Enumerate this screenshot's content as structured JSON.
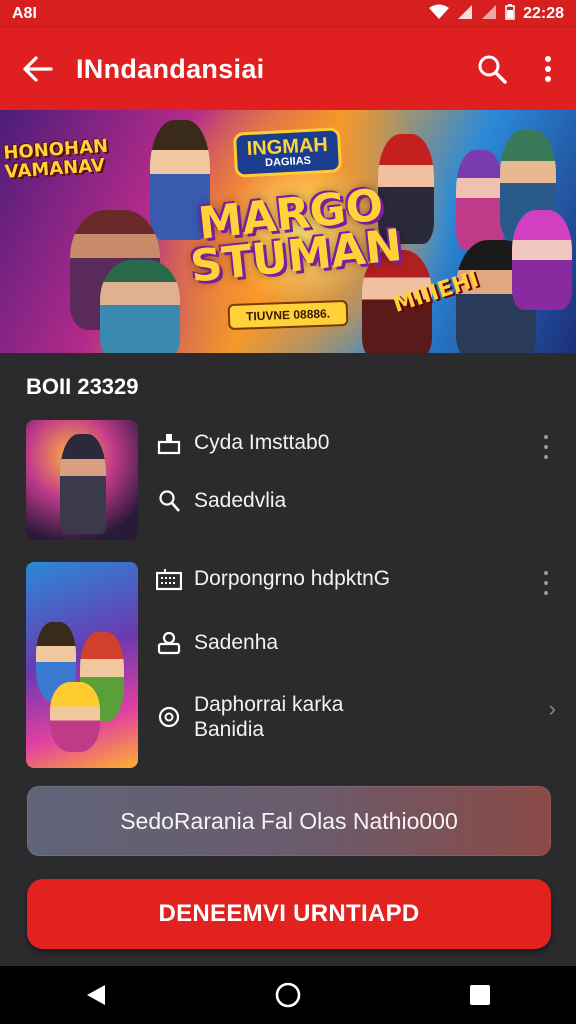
{
  "status_bar": {
    "carrier": "A8I",
    "time": "22:28"
  },
  "app_bar": {
    "title": "INndandansiai",
    "icons": [
      "back-arrow-icon",
      "search-icon",
      "more-vertical-icon"
    ]
  },
  "banner": {
    "top_left_text": [
      "HONOHAN",
      "VAMANAV"
    ],
    "badge_text": "INGMAH",
    "badge_sub": "DAGIIAS",
    "main_title": [
      "MARGO",
      "STUMAN"
    ],
    "ribbon_text": "TIUVNE 08886.",
    "right_text": "MIIIEHI"
  },
  "section": {
    "title": "BOII 23329"
  },
  "items": [
    {
      "rows": [
        {
          "icon": "cake-icon",
          "text": "Cyda Imsttab0"
        },
        {
          "icon": "search-user-icon",
          "text": "Sadedvlia"
        }
      ],
      "trailing": "more-vertical-icon"
    },
    {
      "rows": [
        {
          "icon": "keyboard-icon",
          "text": "Dorpongrno hdpktnG"
        },
        {
          "icon": "user-badge-icon",
          "text": "Sadenha"
        },
        {
          "icon": "refresh-icon",
          "text_line1": "Daphorrai karka",
          "text_line2": "Banidia"
        }
      ],
      "trailing": "more-vertical-icon",
      "chevron": "chevron-right-icon"
    }
  ],
  "info_bar": {
    "text": "SedoRarania Fal Olas Nathio000"
  },
  "cta": {
    "label": "DENEEMVI URNTIAPD"
  },
  "nav": {
    "icons": [
      "back-triangle-icon",
      "home-circle-icon",
      "recents-square-icon"
    ]
  },
  "colors": {
    "primary_red": "#e02020",
    "background": "#2b2b2e",
    "nav_black": "#000000"
  }
}
